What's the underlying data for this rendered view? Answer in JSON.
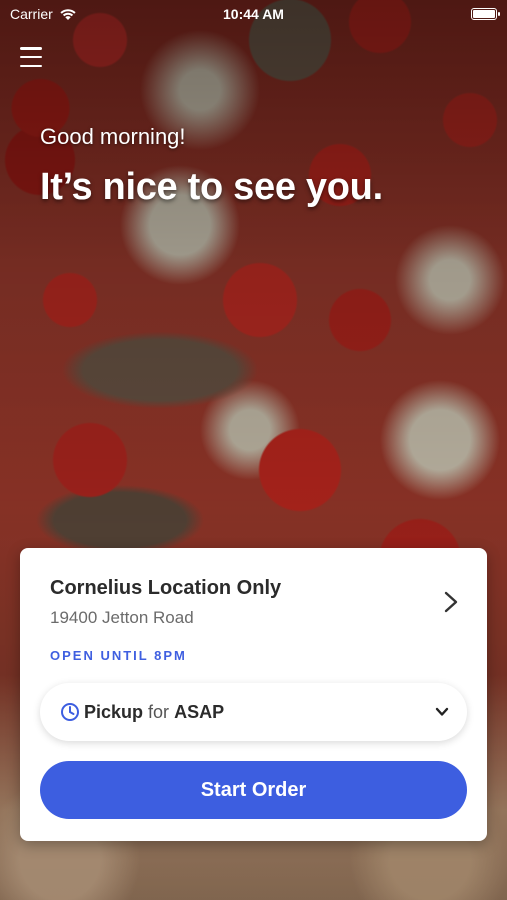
{
  "status_bar": {
    "carrier": "Carrier",
    "time": "10:44 AM",
    "icons": [
      "wifi-icon",
      "battery-icon"
    ]
  },
  "header": {
    "menu_icon": "hamburger-menu-icon",
    "greeting": "Good morning!",
    "headline": "It’s nice to see you."
  },
  "location_card": {
    "name": "Cornelius Location Only",
    "address": "19400 Jetton Road",
    "hours": "OPEN UNTIL 8PM",
    "hours_color": "#3f5fe0",
    "chevron_icon": "chevron-right-icon"
  },
  "order_mode": {
    "icon": "clock-icon",
    "mode": "Pickup",
    "connector": "for",
    "time": "ASAP",
    "dropdown_icon": "chevron-down-icon"
  },
  "actions": {
    "start_order_label": "Start Order",
    "accent_color": "#3d5ee0"
  }
}
